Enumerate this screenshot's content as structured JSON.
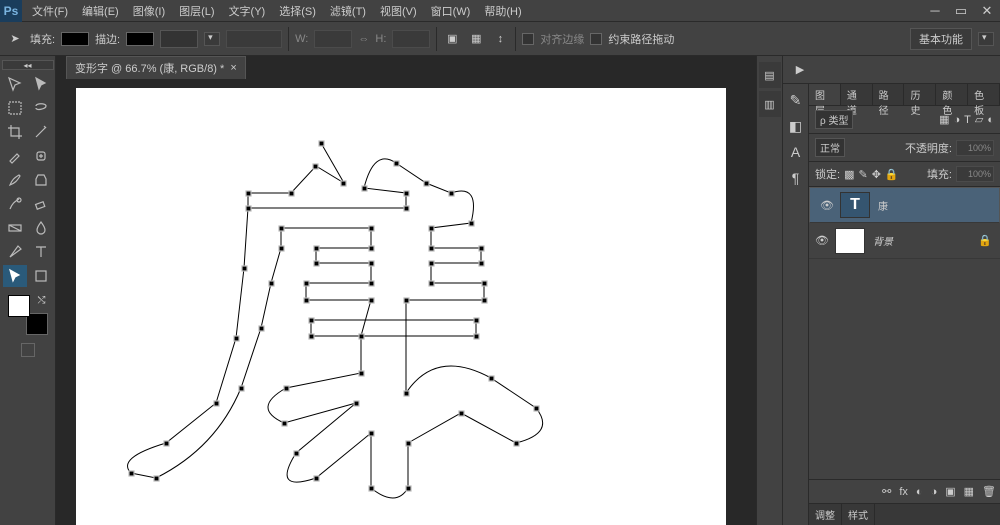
{
  "menu": {
    "file": "文件(F)",
    "edit": "编辑(E)",
    "image": "图像(I)",
    "layer": "图层(L)",
    "type": "文字(Y)",
    "select": "选择(S)",
    "filter": "滤镜(T)",
    "view": "视图(V)",
    "window": "窗口(W)",
    "help": "帮助(H)"
  },
  "options": {
    "fill": "填充:",
    "stroke": "描边:",
    "w": "W:",
    "h": "H:",
    "alignEdges": "对齐边缘",
    "constrain": "约束路径拖动",
    "btn": "基本功能"
  },
  "doc": {
    "tab": "变形字 @ 66.7% (康, RGB/8) *"
  },
  "panels": {
    "tabs": [
      "图层",
      "通道",
      "路径",
      "历史",
      "颜色",
      "色板"
    ],
    "kind": "ρ 类型",
    "blend": "正常",
    "opacityLabel": "不透明度:",
    "opacity": "100%",
    "lock": "锁定:",
    "fillLabel": "填充:",
    "fill": "100%"
  },
  "layers": [
    {
      "name": "康",
      "type": "T"
    },
    {
      "name": "背景",
      "type": "bg",
      "locked": true
    }
  ],
  "bottomTabs": [
    "调整",
    "样式"
  ]
}
